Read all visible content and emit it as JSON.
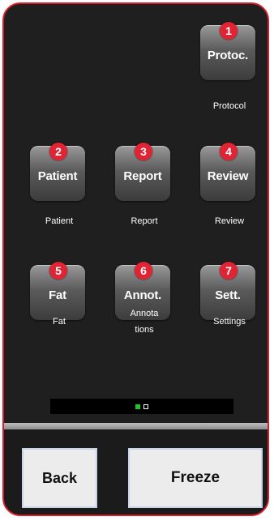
{
  "apps": [
    {
      "badge": "1",
      "label": "Protoc.",
      "caption": "Protocol"
    },
    {
      "badge": "2",
      "label": "Patient",
      "caption": "Patient"
    },
    {
      "badge": "3",
      "label": "Report",
      "caption": "Report"
    },
    {
      "badge": "4",
      "label": "Review",
      "caption": "Review"
    },
    {
      "badge": "5",
      "label": "Fat",
      "caption": "Fat"
    },
    {
      "badge": "6",
      "label": "Annot.",
      "caption_line1": "Annota",
      "caption_line2": "tions"
    },
    {
      "badge": "7",
      "label": "Sett.",
      "caption": "Settings"
    }
  ],
  "page_indicator": {
    "current_page": 1,
    "total_pages": 2,
    "active_color": "#22c235"
  },
  "bottom_bar": {
    "back_label": "Back",
    "freeze_label": "Freeze"
  },
  "colors": {
    "frame": "#d61f2c",
    "badge": "#e02433",
    "background": "#1f1f1f"
  }
}
